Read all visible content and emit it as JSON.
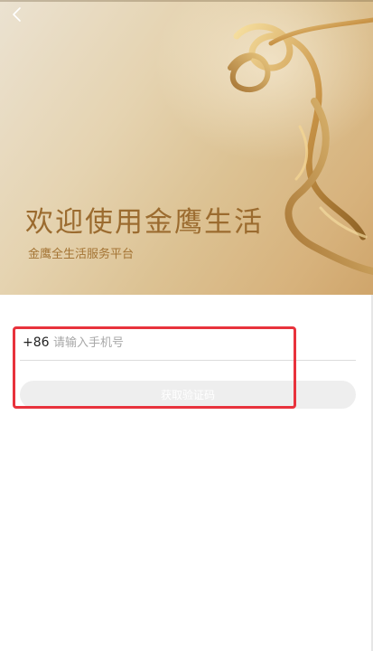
{
  "hero": {
    "title": "欢迎使用金鹰生活",
    "subtitle": "金鹰全生活服务平台"
  },
  "nav": {
    "back_icon": "chevron-left-icon"
  },
  "login": {
    "country_code": "+86",
    "phone_placeholder": "请输入手机号",
    "phone_value": "",
    "get_code_label": "获取验证码"
  },
  "colors": {
    "title_gold": "#9b6b2f",
    "highlight_red": "#e8323c",
    "button_disabled_bg": "#eeeeee"
  }
}
